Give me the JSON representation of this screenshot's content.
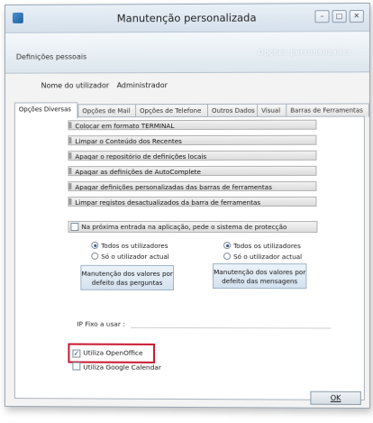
{
  "window": {
    "title": "Manutenção personalizada",
    "minimize_glyph": "–",
    "maximize_glyph": "□",
    "close_glyph": "✕"
  },
  "header": {
    "label": "Definições pessoais",
    "ghost_text": "Opções personalizadas"
  },
  "user": {
    "label": "Nome do utilizador",
    "value": "Administrador"
  },
  "tabs": [
    {
      "label": "Opções Diversas",
      "active": true
    },
    {
      "label": "Opções de Mail",
      "active": false
    },
    {
      "label": "Opções de Telefone",
      "active": false
    },
    {
      "label": "Outros Dados",
      "active": false
    },
    {
      "label": "Visual",
      "active": false
    },
    {
      "label": "Barras de Ferramentas",
      "active": false
    }
  ],
  "actions": [
    "Colocar em formato TERMINAL",
    "Limpar o Conteúdo dos Recentes",
    "Apagar o repositório de definições locais",
    "Apagar as definições de AutoComplete",
    "Apagar definições personalizadas das barras de ferramentas",
    "Limpar registos desactualizados da barra de ferramentas"
  ],
  "protection": {
    "label": "Na próxima entrada na aplicação, pede o sistema de protecção",
    "checked": false
  },
  "left_group": {
    "radio_all": "Todos os utilizadores",
    "radio_current": "Só o utilizador actual",
    "selected": "all",
    "button": "Manutenção dos valores por defeito das perguntas"
  },
  "right_group": {
    "radio_all": "Todos os utilizadores",
    "radio_current": "Só o utilizador actual",
    "selected": "all",
    "button": "Manutenção dos valores por defeito das mensagens"
  },
  "ip": {
    "label": "IP Fixo a usar :",
    "value": ""
  },
  "options": {
    "openoffice": {
      "label": "Utiliza OpenOffice",
      "checked": true
    },
    "google_calendar": {
      "label": "Utiliza Google Calendar",
      "checked": false
    }
  },
  "ok_label": "OK",
  "colors": {
    "highlight": "#c8162f",
    "header_gradient_bottom": "#dde6ee",
    "button_blue": "#d4e2ef"
  }
}
